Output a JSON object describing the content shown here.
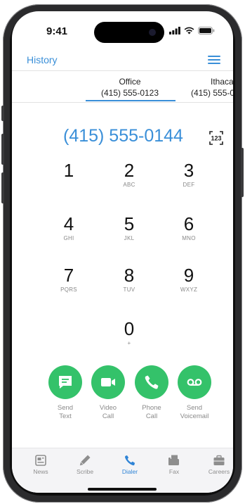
{
  "status_bar": {
    "time": "9:41"
  },
  "nav": {
    "title": "History",
    "menu_icon": "hamburger-icon"
  },
  "accounts": [
    {
      "name": "Office",
      "number": "(415) 555-0123",
      "selected": true
    },
    {
      "name": "Ithaca",
      "number": "(415) 555-0",
      "selected": false
    }
  ],
  "dialer": {
    "number": "(415) 555-0144",
    "keyboard_icon_label": "123"
  },
  "keypad": [
    {
      "digit": "1",
      "letters": ""
    },
    {
      "digit": "2",
      "letters": "ABC"
    },
    {
      "digit": "3",
      "letters": "DEF"
    },
    {
      "digit": "4",
      "letters": "GHI"
    },
    {
      "digit": "5",
      "letters": "JKL"
    },
    {
      "digit": "6",
      "letters": "MNO"
    },
    {
      "digit": "7",
      "letters": "PQRS"
    },
    {
      "digit": "8",
      "letters": "TUV"
    },
    {
      "digit": "9",
      "letters": "WXYZ"
    },
    {
      "digit": "0",
      "letters": "+"
    }
  ],
  "actions": [
    {
      "line1": "Send",
      "line2": "Text",
      "icon": "message-icon"
    },
    {
      "line1": "Video",
      "line2": "Call",
      "icon": "video-icon"
    },
    {
      "line1": "Phone",
      "line2": "Call",
      "icon": "phone-icon"
    },
    {
      "line1": "Send",
      "line2": "Voicemail",
      "icon": "voicemail-icon"
    }
  ],
  "tabs": [
    {
      "label": "News",
      "icon": "news-icon",
      "active": false
    },
    {
      "label": "Scribe",
      "icon": "scribe-icon",
      "active": false
    },
    {
      "label": "Dialer",
      "icon": "phone-icon",
      "active": true
    },
    {
      "label": "Fax",
      "icon": "fax-icon",
      "active": false
    },
    {
      "label": "Careers",
      "icon": "briefcase-icon",
      "active": false
    }
  ],
  "colors": {
    "accent": "#3a8fd8",
    "action_green": "#34c26a",
    "tab_active": "#2f84d6"
  }
}
